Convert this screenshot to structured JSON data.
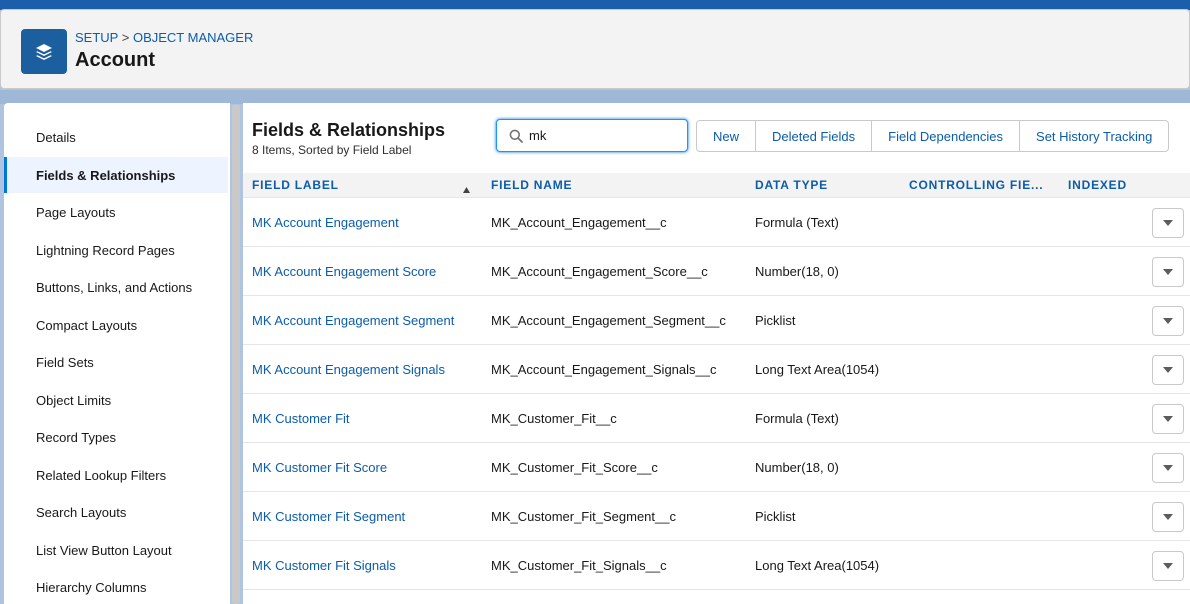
{
  "header": {
    "breadcrumb_setup": "SETUP",
    "breadcrumb_sep": ">",
    "breadcrumb_object_manager": "OBJECT MANAGER",
    "title": "Account",
    "icon": "layers-icon"
  },
  "sidebar": {
    "items": [
      {
        "label": "Details"
      },
      {
        "label": "Fields & Relationships",
        "active": true
      },
      {
        "label": "Page Layouts"
      },
      {
        "label": "Lightning Record Pages"
      },
      {
        "label": "Buttons, Links, and Actions"
      },
      {
        "label": "Compact Layouts"
      },
      {
        "label": "Field Sets"
      },
      {
        "label": "Object Limits"
      },
      {
        "label": "Record Types"
      },
      {
        "label": "Related Lookup Filters"
      },
      {
        "label": "Search Layouts"
      },
      {
        "label": "List View Button Layout"
      },
      {
        "label": "Hierarchy Columns"
      }
    ]
  },
  "main": {
    "title": "Fields & Relationships",
    "subtitle": "8 Items, Sorted by Field Label",
    "search": {
      "value": "mk",
      "icon": "search-icon"
    },
    "buttons": {
      "new": "New",
      "deleted_fields": "Deleted Fields",
      "field_dependencies": "Field Dependencies",
      "set_history_tracking": "Set History Tracking"
    },
    "columns": {
      "field_label": "FIELD LABEL",
      "field_name": "FIELD NAME",
      "data_type": "DATA TYPE",
      "controlling_field": "CONTROLLING FIE...",
      "indexed": "INDEXED"
    },
    "rows": [
      {
        "label": "MK Account Engagement",
        "name": "MK_Account_Engagement__c",
        "type": "Formula (Text)"
      },
      {
        "label": "MK Account Engagement Score",
        "name": "MK_Account_Engagement_Score__c",
        "type": "Number(18, 0)"
      },
      {
        "label": "MK Account Engagement Segment",
        "name": "MK_Account_Engagement_Segment__c",
        "type": "Picklist"
      },
      {
        "label": "MK Account Engagement Signals",
        "name": "MK_Account_Engagement_Signals__c",
        "type": "Long Text Area(1054)"
      },
      {
        "label": "MK Customer Fit",
        "name": "MK_Customer_Fit__c",
        "type": "Formula (Text)"
      },
      {
        "label": "MK Customer Fit Score",
        "name": "MK_Customer_Fit_Score__c",
        "type": "Number(18, 0)"
      },
      {
        "label": "MK Customer Fit Segment",
        "name": "MK_Customer_Fit_Segment__c",
        "type": "Picklist"
      },
      {
        "label": "MK Customer Fit Signals",
        "name": "MK_Customer_Fit_Signals__c",
        "type": "Long Text Area(1054)"
      }
    ]
  },
  "colors": {
    "brand_blue": "#0b5cab",
    "icon_bg": "#1b5f9e",
    "active_bg": "#eef4ff"
  }
}
